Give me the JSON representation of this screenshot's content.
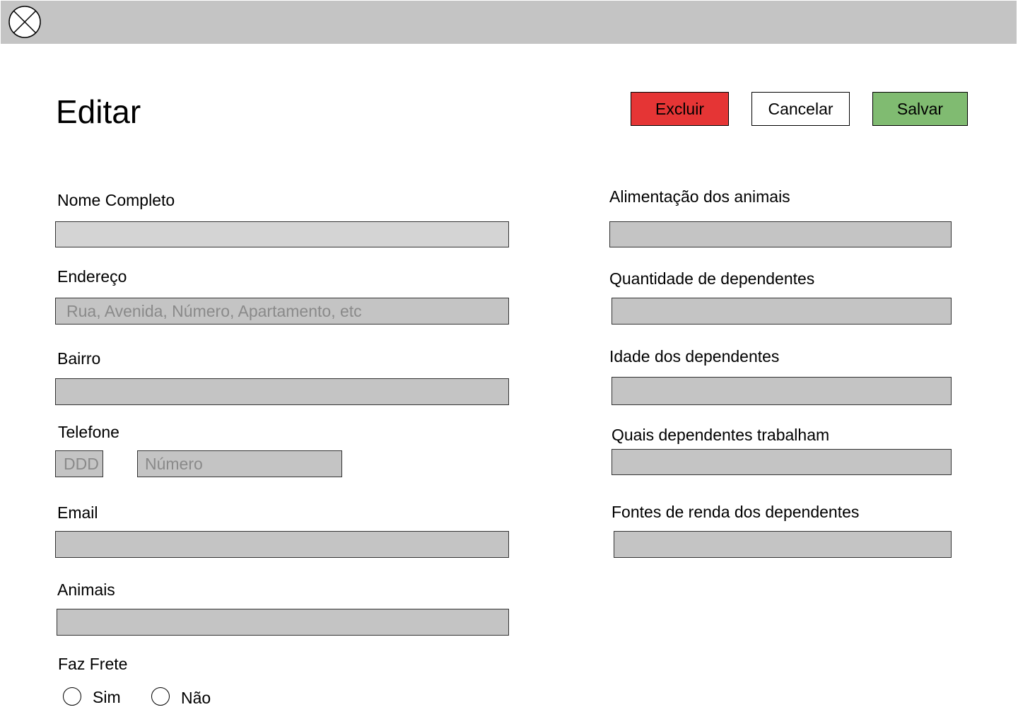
{
  "page": {
    "title": "Editar"
  },
  "header": {
    "logo_icon": "close-circle-icon"
  },
  "actions": {
    "delete_label": "Excluir",
    "cancel_label": "Cancelar",
    "save_label": "Salvar"
  },
  "colors": {
    "delete": "#e53535",
    "save": "#80bb71",
    "field": "#c4c4c4",
    "topbar": "#c4c4c4"
  },
  "left_form": {
    "nome": {
      "label": "Nome Completo",
      "value": ""
    },
    "endereco": {
      "label": "Endereço",
      "value": "",
      "placeholder": "Rua, Avenida, Número, Apartamento, etc"
    },
    "bairro": {
      "label": "Bairro",
      "value": ""
    },
    "telefone": {
      "label": "Telefone",
      "ddd_placeholder": "DDD",
      "numero_placeholder": "Número"
    },
    "email": {
      "label": "Email",
      "value": ""
    },
    "animais": {
      "label": "Animais",
      "value": ""
    },
    "faz_frete": {
      "label": "Faz Frete",
      "options": [
        "Sim",
        "Não"
      ],
      "selected": null
    }
  },
  "right_form": {
    "alimentacao": {
      "label": "Alimentação dos animais",
      "value": ""
    },
    "quantidade": {
      "label": "Quantidade de dependentes",
      "value": ""
    },
    "idade": {
      "label": "Idade dos dependentes",
      "value": ""
    },
    "trabalham": {
      "label": "Quais dependentes trabalham",
      "value": ""
    },
    "renda": {
      "label": "Fontes de renda dos dependentes",
      "value": ""
    }
  }
}
